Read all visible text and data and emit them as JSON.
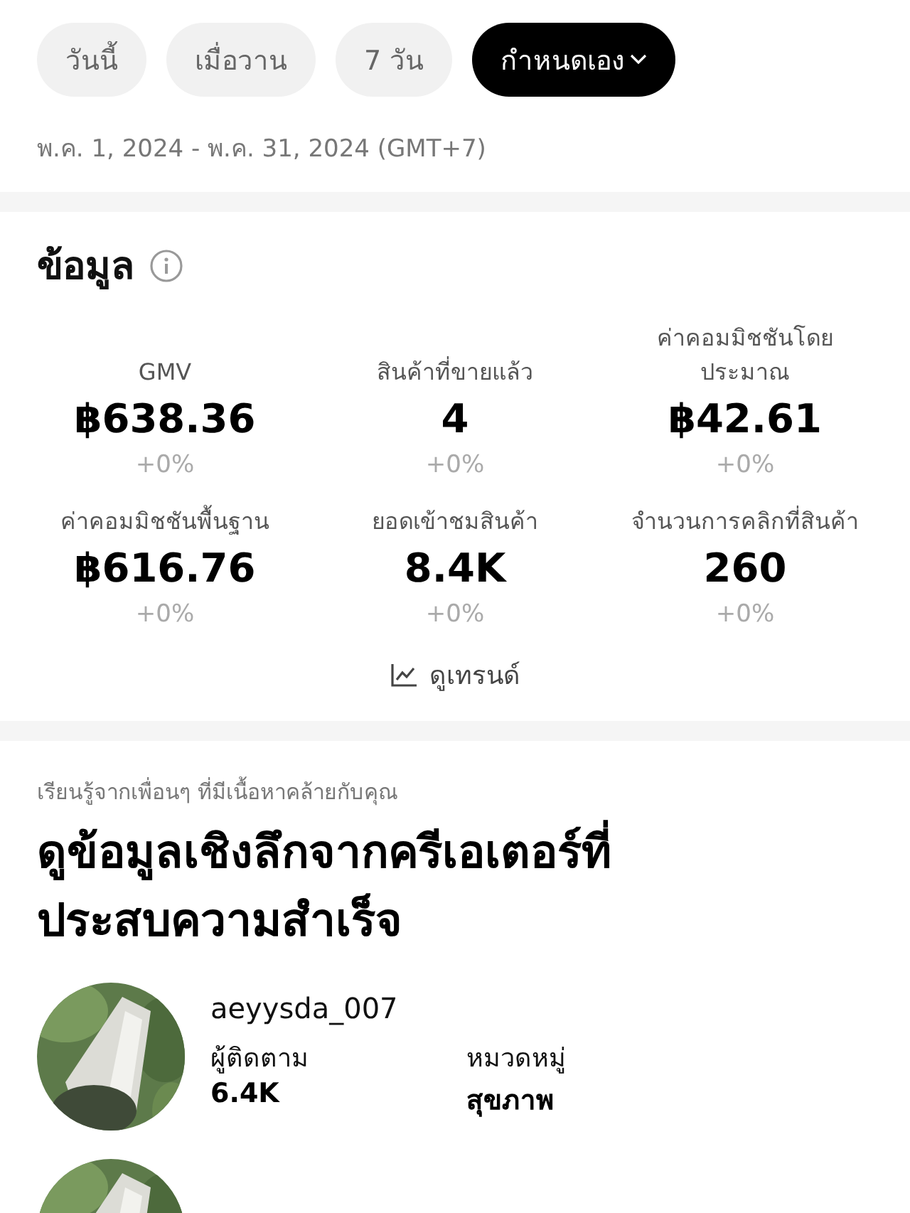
{
  "date_filters": [
    {
      "label": "วันนี้",
      "selected": false,
      "dropdown": false
    },
    {
      "label": "เมื่อวาน",
      "selected": false,
      "dropdown": false
    },
    {
      "label": "7 วัน",
      "selected": false,
      "dropdown": false
    },
    {
      "label": "กำหนดเอง",
      "selected": true,
      "dropdown": true
    }
  ],
  "date_range": "พ.ค. 1, 2024 - พ.ค. 31, 2024 (GMT+7)",
  "info": {
    "title": "ข้อมูล",
    "metrics": [
      {
        "label": "GMV",
        "value": "฿638.36",
        "change": "+0%"
      },
      {
        "label": "สินค้าที่ขายแล้ว",
        "value": "4",
        "change": "+0%"
      },
      {
        "label": "ค่าคอมมิชชันโดยประมาณ",
        "value": "฿42.61",
        "change": "+0%"
      },
      {
        "label": "ค่าคอมมิชชันพื้นฐาน",
        "value": "฿616.76",
        "change": "+0%"
      },
      {
        "label": "ยอดเข้าชมสินค้า",
        "value": "8.4K",
        "change": "+0%"
      },
      {
        "label": "จำนวนการคลิกที่สินค้า",
        "value": "260",
        "change": "+0%"
      }
    ],
    "trend_link": "ดูเทรนด์"
  },
  "creators_section": {
    "subtitle": "เรียนรู้จากเพื่อนๆ ที่มีเนื้อหาคล้ายกับคุณ",
    "title": "ดูข้อมูลเชิงลึกจากครีเอเตอร์ที่ประสบความสำเร็จ",
    "creators": [
      {
        "avatar": {
          "kind": "picture"
        },
        "name": "aeyysda_007",
        "stats": [
          {
            "label": "ผู้ติดตาม",
            "value": "6.4K"
          },
          {
            "label": "หมวดหมู่",
            "value": "สุขภาพ"
          }
        ]
      },
      {
        "avatar": {
          "kind": "picture"
        }
      }
    ]
  }
}
